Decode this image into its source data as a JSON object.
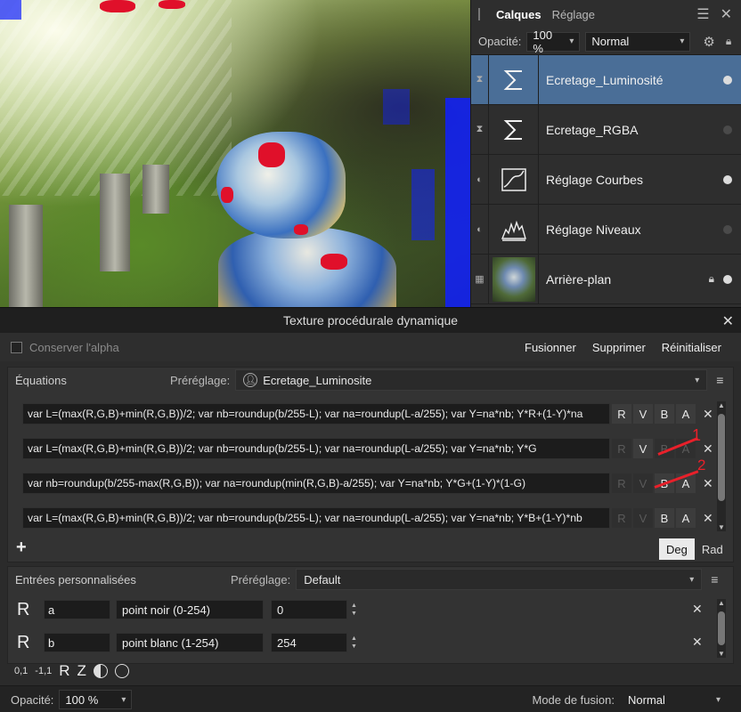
{
  "layers_panel": {
    "tabs": [
      "Calques",
      "Réglage"
    ],
    "opacity_label": "Opacité:",
    "opacity_value": "100 %",
    "blend_mode": "Normal",
    "layers": [
      {
        "name": "Ecretage_Luminosité",
        "icon": "sigma-icon",
        "selected": true
      },
      {
        "name": "Ecretage_RGBA",
        "icon": "sigma-icon",
        "selected": false
      },
      {
        "name": "Réglage Courbes",
        "icon": "curves-icon",
        "selected": false
      },
      {
        "name": "Réglage Niveaux",
        "icon": "levels-icon",
        "selected": false
      },
      {
        "name": "Arrière-plan",
        "icon": "image-thumbnail",
        "selected": false
      }
    ]
  },
  "dialog": {
    "title": "Texture procédurale dynamique",
    "preserve_alpha": "Conserver l'alpha",
    "buttons": {
      "merge": "Fusionner",
      "delete": "Supprimer",
      "reset": "Réinitialiser"
    },
    "equations": {
      "section_title": "Équations",
      "preset_label": "Préréglage:",
      "preset_value": "Ecretage_Luminosite",
      "rows": [
        {
          "expr": "var L=(max(R,G,B)+min(R,G,B))/2; var nb=roundup(b/255-L); var na=roundup(L-a/255); var Y=na*nb;  Y*R+(1-Y)*na"
        },
        {
          "expr": "var L=(max(R,G,B)+min(R,G,B))/2; var nb=roundup(b/255-L); var na=roundup(L-a/255); var Y=na*nb;  Y*G"
        },
        {
          "expr": "var nb=roundup(b/255-max(R,G,B)); var na=roundup(min(R,G,B)-a/255); var Y=na*nb; Y*G+(1-Y)*(1-G)"
        },
        {
          "expr": "var L=(max(R,G,B)+min(R,G,B))/2; var nb=roundup(b/255-L); var na=roundup(L-a/255); var Y=na*nb;  Y*B+(1-Y)*nb"
        }
      ],
      "channels": [
        "R",
        "V",
        "B",
        "A"
      ],
      "annotations": [
        "1",
        "2"
      ],
      "angle_units": [
        "Deg",
        "Rad"
      ]
    },
    "custom_inputs": {
      "section_title": "Entrées personnalisées",
      "preset_label": "Préréglage:",
      "preset_value": "Default",
      "rows": [
        {
          "channel": "R",
          "name": "a",
          "description": "point noir (0-254)",
          "value": "0"
        },
        {
          "channel": "R",
          "name": "b",
          "description": "point blanc (1-254)",
          "value": "254"
        }
      ],
      "tools": [
        "0,1",
        "-1,1",
        "R",
        "Z"
      ]
    },
    "footer": {
      "opacity_label": "Opacité:",
      "opacity_value": "100 %",
      "blend_label": "Mode de fusion:",
      "blend_value": "Normal"
    }
  }
}
